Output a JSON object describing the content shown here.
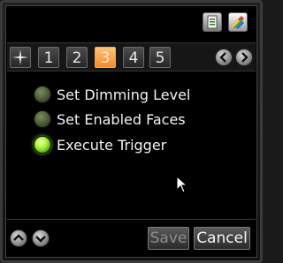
{
  "toolbar": {
    "icons": [
      "document-icon",
      "palette-icon"
    ]
  },
  "tabs": {
    "items": [
      {
        "label": "",
        "icon": "star-icon"
      },
      {
        "label": "1"
      },
      {
        "label": "2"
      },
      {
        "label": "3",
        "active": true
      },
      {
        "label": "4"
      },
      {
        "label": "5"
      }
    ],
    "nav": [
      "chevron-left-icon",
      "chevron-right-icon"
    ]
  },
  "list": {
    "items": [
      {
        "label": "Set Dimming Level",
        "state": "off"
      },
      {
        "label": "Set Enabled Faces",
        "state": "off"
      },
      {
        "label": "Execute Trigger",
        "state": "on"
      }
    ]
  },
  "footer": {
    "save_label": "Save",
    "cancel_label": "Cancel"
  },
  "colors": {
    "active_tab": "#f5a04a",
    "led_on": "#9cf02a",
    "background": "#000000"
  }
}
